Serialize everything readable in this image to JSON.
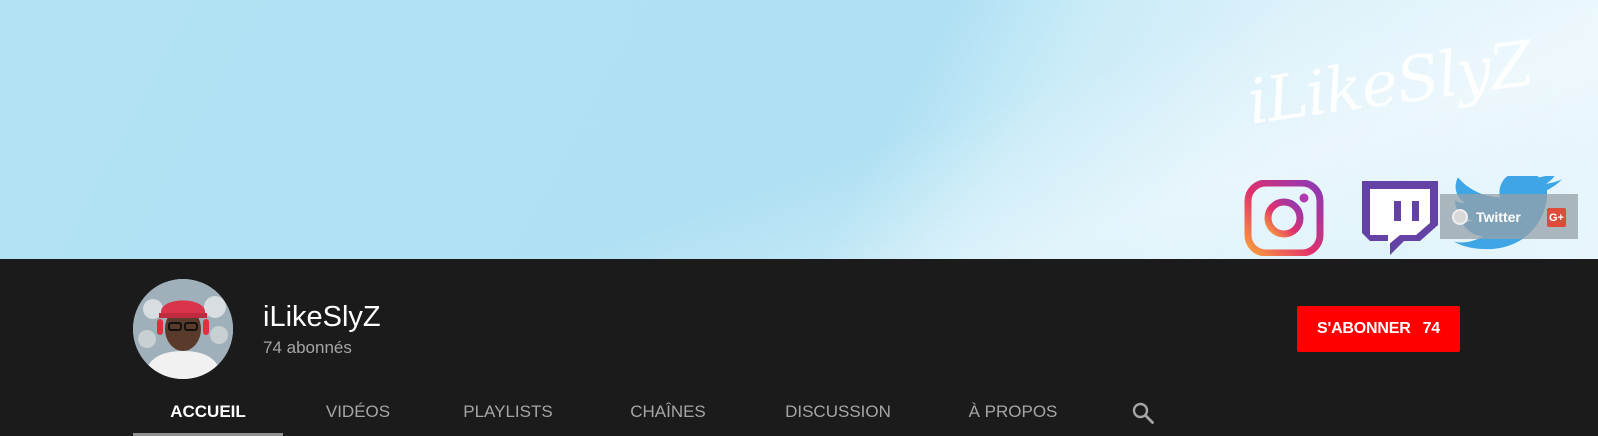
{
  "banner": {
    "signature_text": "iLikeSlyZ",
    "links": [
      {
        "label": "Twitter",
        "icon": "globe-icon"
      }
    ],
    "extra_icon": "G+",
    "social_icons": [
      "instagram-icon",
      "twitch-icon",
      "twitter-icon"
    ]
  },
  "channel": {
    "name": "iLikeSlyZ",
    "subscribers": "74 abonnés",
    "avatar_icon": "avatar"
  },
  "subscribe": {
    "label": "S'ABONNER",
    "count": "74",
    "color": "#ff0000"
  },
  "tabs": [
    {
      "label": "ACCUEIL",
      "active": true
    },
    {
      "label": "VIDÉOS",
      "active": false
    },
    {
      "label": "PLAYLISTS",
      "active": false
    },
    {
      "label": "CHAÎNES",
      "active": false
    },
    {
      "label": "DISCUSSION",
      "active": false
    },
    {
      "label": "À PROPOS",
      "active": false
    }
  ],
  "colors": {
    "background": "#1b1b1b",
    "banner": "#b2e2f4",
    "accent": "#ff0000",
    "active_tab_underline": "#909090"
  }
}
